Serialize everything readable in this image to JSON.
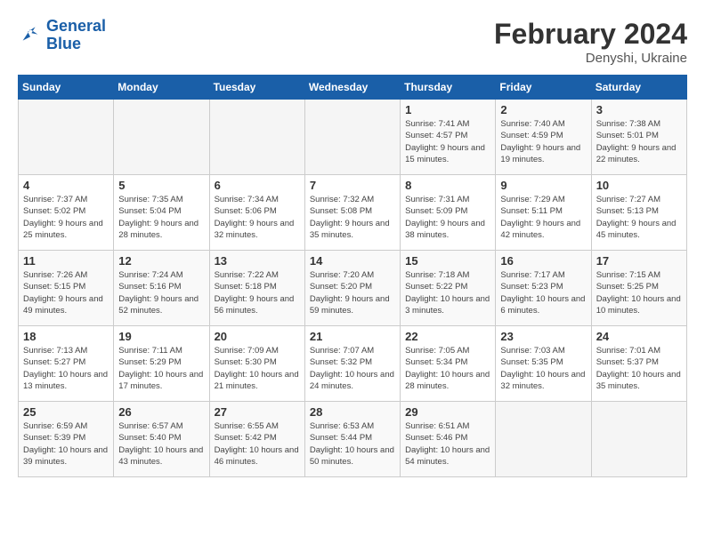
{
  "logo": {
    "text_general": "General",
    "text_blue": "Blue"
  },
  "title": {
    "month_year": "February 2024",
    "location": "Denyshi, Ukraine"
  },
  "headers": [
    "Sunday",
    "Monday",
    "Tuesday",
    "Wednesday",
    "Thursday",
    "Friday",
    "Saturday"
  ],
  "weeks": [
    [
      {
        "day": "",
        "sunrise": "",
        "sunset": "",
        "daylight": ""
      },
      {
        "day": "",
        "sunrise": "",
        "sunset": "",
        "daylight": ""
      },
      {
        "day": "",
        "sunrise": "",
        "sunset": "",
        "daylight": ""
      },
      {
        "day": "",
        "sunrise": "",
        "sunset": "",
        "daylight": ""
      },
      {
        "day": "1",
        "sunrise": "Sunrise: 7:41 AM",
        "sunset": "Sunset: 4:57 PM",
        "daylight": "Daylight: 9 hours and 15 minutes."
      },
      {
        "day": "2",
        "sunrise": "Sunrise: 7:40 AM",
        "sunset": "Sunset: 4:59 PM",
        "daylight": "Daylight: 9 hours and 19 minutes."
      },
      {
        "day": "3",
        "sunrise": "Sunrise: 7:38 AM",
        "sunset": "Sunset: 5:01 PM",
        "daylight": "Daylight: 9 hours and 22 minutes."
      }
    ],
    [
      {
        "day": "4",
        "sunrise": "Sunrise: 7:37 AM",
        "sunset": "Sunset: 5:02 PM",
        "daylight": "Daylight: 9 hours and 25 minutes."
      },
      {
        "day": "5",
        "sunrise": "Sunrise: 7:35 AM",
        "sunset": "Sunset: 5:04 PM",
        "daylight": "Daylight: 9 hours and 28 minutes."
      },
      {
        "day": "6",
        "sunrise": "Sunrise: 7:34 AM",
        "sunset": "Sunset: 5:06 PM",
        "daylight": "Daylight: 9 hours and 32 minutes."
      },
      {
        "day": "7",
        "sunrise": "Sunrise: 7:32 AM",
        "sunset": "Sunset: 5:08 PM",
        "daylight": "Daylight: 9 hours and 35 minutes."
      },
      {
        "day": "8",
        "sunrise": "Sunrise: 7:31 AM",
        "sunset": "Sunset: 5:09 PM",
        "daylight": "Daylight: 9 hours and 38 minutes."
      },
      {
        "day": "9",
        "sunrise": "Sunrise: 7:29 AM",
        "sunset": "Sunset: 5:11 PM",
        "daylight": "Daylight: 9 hours and 42 minutes."
      },
      {
        "day": "10",
        "sunrise": "Sunrise: 7:27 AM",
        "sunset": "Sunset: 5:13 PM",
        "daylight": "Daylight: 9 hours and 45 minutes."
      }
    ],
    [
      {
        "day": "11",
        "sunrise": "Sunrise: 7:26 AM",
        "sunset": "Sunset: 5:15 PM",
        "daylight": "Daylight: 9 hours and 49 minutes."
      },
      {
        "day": "12",
        "sunrise": "Sunrise: 7:24 AM",
        "sunset": "Sunset: 5:16 PM",
        "daylight": "Daylight: 9 hours and 52 minutes."
      },
      {
        "day": "13",
        "sunrise": "Sunrise: 7:22 AM",
        "sunset": "Sunset: 5:18 PM",
        "daylight": "Daylight: 9 hours and 56 minutes."
      },
      {
        "day": "14",
        "sunrise": "Sunrise: 7:20 AM",
        "sunset": "Sunset: 5:20 PM",
        "daylight": "Daylight: 9 hours and 59 minutes."
      },
      {
        "day": "15",
        "sunrise": "Sunrise: 7:18 AM",
        "sunset": "Sunset: 5:22 PM",
        "daylight": "Daylight: 10 hours and 3 minutes."
      },
      {
        "day": "16",
        "sunrise": "Sunrise: 7:17 AM",
        "sunset": "Sunset: 5:23 PM",
        "daylight": "Daylight: 10 hours and 6 minutes."
      },
      {
        "day": "17",
        "sunrise": "Sunrise: 7:15 AM",
        "sunset": "Sunset: 5:25 PM",
        "daylight": "Daylight: 10 hours and 10 minutes."
      }
    ],
    [
      {
        "day": "18",
        "sunrise": "Sunrise: 7:13 AM",
        "sunset": "Sunset: 5:27 PM",
        "daylight": "Daylight: 10 hours and 13 minutes."
      },
      {
        "day": "19",
        "sunrise": "Sunrise: 7:11 AM",
        "sunset": "Sunset: 5:29 PM",
        "daylight": "Daylight: 10 hours and 17 minutes."
      },
      {
        "day": "20",
        "sunrise": "Sunrise: 7:09 AM",
        "sunset": "Sunset: 5:30 PM",
        "daylight": "Daylight: 10 hours and 21 minutes."
      },
      {
        "day": "21",
        "sunrise": "Sunrise: 7:07 AM",
        "sunset": "Sunset: 5:32 PM",
        "daylight": "Daylight: 10 hours and 24 minutes."
      },
      {
        "day": "22",
        "sunrise": "Sunrise: 7:05 AM",
        "sunset": "Sunset: 5:34 PM",
        "daylight": "Daylight: 10 hours and 28 minutes."
      },
      {
        "day": "23",
        "sunrise": "Sunrise: 7:03 AM",
        "sunset": "Sunset: 5:35 PM",
        "daylight": "Daylight: 10 hours and 32 minutes."
      },
      {
        "day": "24",
        "sunrise": "Sunrise: 7:01 AM",
        "sunset": "Sunset: 5:37 PM",
        "daylight": "Daylight: 10 hours and 35 minutes."
      }
    ],
    [
      {
        "day": "25",
        "sunrise": "Sunrise: 6:59 AM",
        "sunset": "Sunset: 5:39 PM",
        "daylight": "Daylight: 10 hours and 39 minutes."
      },
      {
        "day": "26",
        "sunrise": "Sunrise: 6:57 AM",
        "sunset": "Sunset: 5:40 PM",
        "daylight": "Daylight: 10 hours and 43 minutes."
      },
      {
        "day": "27",
        "sunrise": "Sunrise: 6:55 AM",
        "sunset": "Sunset: 5:42 PM",
        "daylight": "Daylight: 10 hours and 46 minutes."
      },
      {
        "day": "28",
        "sunrise": "Sunrise: 6:53 AM",
        "sunset": "Sunset: 5:44 PM",
        "daylight": "Daylight: 10 hours and 50 minutes."
      },
      {
        "day": "29",
        "sunrise": "Sunrise: 6:51 AM",
        "sunset": "Sunset: 5:46 PM",
        "daylight": "Daylight: 10 hours and 54 minutes."
      },
      {
        "day": "",
        "sunrise": "",
        "sunset": "",
        "daylight": ""
      },
      {
        "day": "",
        "sunrise": "",
        "sunset": "",
        "daylight": ""
      }
    ]
  ]
}
